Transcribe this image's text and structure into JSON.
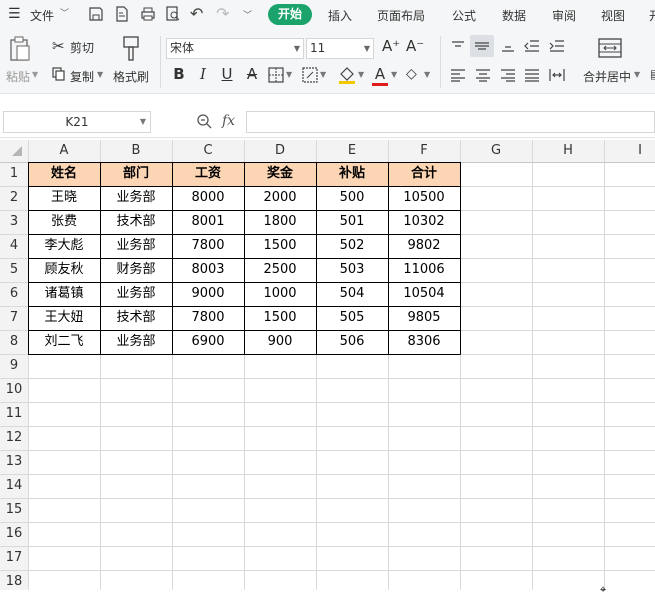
{
  "menubar": {
    "file_label": "文件",
    "tabs": [
      "开始",
      "插入",
      "页面布局",
      "公式",
      "数据",
      "审阅",
      "视图",
      "开"
    ]
  },
  "ribbon": {
    "paste_label": "粘贴",
    "cut_label": "剪切",
    "copy_label": "复制",
    "format_painter_label": "格式刷",
    "font_name": "宋体",
    "font_size": "11",
    "merge_label": "合并居中"
  },
  "formula_bar": {
    "cell_ref": "K21",
    "fx_label": "fx",
    "formula": ""
  },
  "sheet": {
    "columns": [
      "A",
      "B",
      "C",
      "D",
      "E",
      "F",
      "G",
      "H",
      "I"
    ],
    "rows": [
      "1",
      "2",
      "3",
      "4",
      "5",
      "6",
      "7",
      "8",
      "9",
      "10",
      "11",
      "12",
      "13",
      "14",
      "15",
      "16",
      "17",
      "18"
    ],
    "header": [
      "姓名",
      "部门",
      "工资",
      "奖金",
      "补贴",
      "合计"
    ],
    "data": [
      [
        "王晓",
        "业务部",
        "8000",
        "2000",
        "500",
        "10500"
      ],
      [
        "张费",
        "技术部",
        "8001",
        "1800",
        "501",
        "10302"
      ],
      [
        "李大彪",
        "业务部",
        "7800",
        "1500",
        "502",
        "9802"
      ],
      [
        "顾友秋",
        "财务部",
        "8003",
        "2500",
        "503",
        "11006"
      ],
      [
        "诸葛镇",
        "业务部",
        "9000",
        "1000",
        "504",
        "10504"
      ],
      [
        "王大妞",
        "技术部",
        "7800",
        "1500",
        "505",
        "9805"
      ],
      [
        "刘二飞",
        "业务部",
        "6900",
        "900",
        "506",
        "8306"
      ]
    ],
    "header_fill": "#fcd5b4",
    "grid_color": "#d9d9d9",
    "table_border_color": "#000000"
  },
  "colors": {
    "accent": "#1aa36b",
    "toolbar_bg": "#f5f6f7"
  }
}
